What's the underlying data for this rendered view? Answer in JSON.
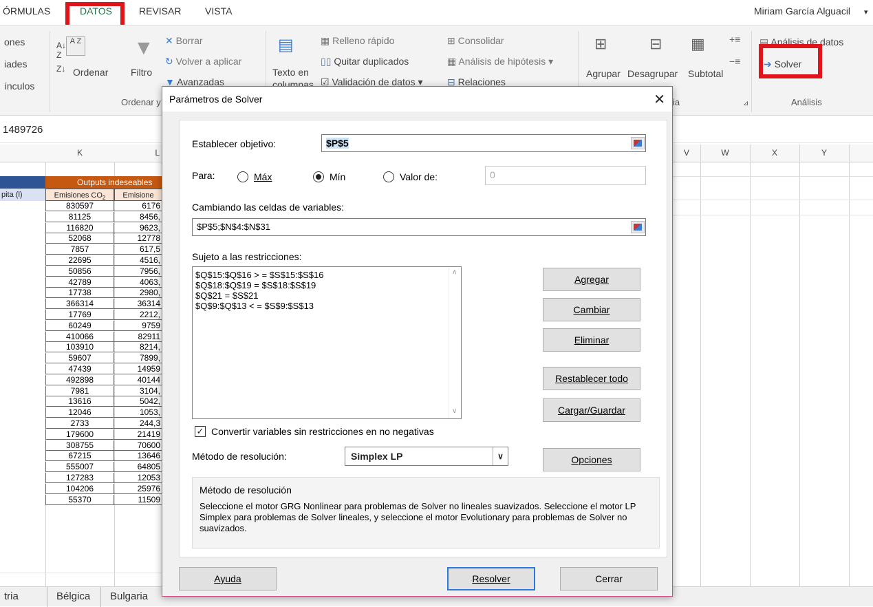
{
  "ribbon_tabs": [
    "ÓRMULAS",
    "DATOS",
    "REVISAR",
    "VISTA"
  ],
  "user_name": "Miriam García Alguacil",
  "ribbon": {
    "left_partial": [
      "ones",
      "iades",
      "ínculos"
    ],
    "ordenar": "Ordenar",
    "filtro": "Filtro",
    "borrar": "Borrar",
    "volver_aplicar": "Volver a aplicar",
    "avanzadas": "Avanzadas",
    "texto_en": "Texto en",
    "columnas": "columnas",
    "relleno_rapido": "Relleno rápido",
    "quitar_duplicados": "Quitar duplicados",
    "validacion": "Validación de datos",
    "consolidar": "Consolidar",
    "analisis_hipotesis": "Análisis de hipótesis",
    "relaciones": "Relaciones",
    "agrupar": "Agrupar",
    "desagrupar": "Desagrupar",
    "subtotal": "Subtotal",
    "analisis_datos": "Análisis de datos",
    "solver": "Solver",
    "group_ordenar": "Ordenar y",
    "group_partial": "ia",
    "group_analisis": "Análisis"
  },
  "name_box": "1489726",
  "columns": [
    "K",
    "L",
    "V",
    "W",
    "X",
    "Y"
  ],
  "sheet": {
    "header_orange": "Outputs indeseables",
    "left_header": "pita (l)",
    "k_header": "Emisiones CO",
    "k_header_sub": "2",
    "l_header": "Emisione",
    "k_values": [
      "830597",
      "81125",
      "116820",
      "52068",
      "7857",
      "22695",
      "50856",
      "42789",
      "17738",
      "366314",
      "17769",
      "60249",
      "410066",
      "103910",
      "59607",
      "47439",
      "492898",
      "7981",
      "13616",
      "12046",
      "2733",
      "179600",
      "308755",
      "67215",
      "555007",
      "127283",
      "104206",
      "55370"
    ],
    "l_values": [
      "6176",
      "8456,",
      "9623,",
      "12778",
      "617,5",
      "4516,",
      "7956,",
      "4063,",
      "2980,",
      "36314",
      "2212,",
      "9759",
      "82911",
      "8214,",
      "7899,",
      "14959",
      "40144",
      "3104,",
      "5042,",
      "1053,",
      "244,3",
      "21419",
      "70600",
      "13646",
      "64805",
      "12053",
      "25976",
      "11509"
    ]
  },
  "sheet_tabs": [
    "tria",
    "Bélgica",
    "Bulgaria"
  ],
  "dialog": {
    "title": "Parámetros de Solver",
    "objective_label": "Establecer objetivo:",
    "objective_value": "$P$5",
    "para_label": "Para:",
    "max_label": "Máx",
    "min_label": "Mín",
    "valor_label": "Valor de:",
    "valor_value": "0",
    "changing_label": "Cambiando las celdas de variables:",
    "changing_value": "$P$5;$N$4:$N$31",
    "subject_label": "Sujeto a las restricciones:",
    "constraints": [
      "$Q$15:$Q$16 > = $S$15:$S$16",
      "$Q$18:$Q$19 = $S$18:$S$19",
      "$Q$21 = $S$21",
      "$Q$9:$Q$13 < = $S$9:$S$13"
    ],
    "btn_agregar": "Agregar",
    "btn_cambiar": "Cambiar",
    "btn_eliminar": "Eliminar",
    "btn_restablecer": "Restablecer todo",
    "btn_cargar": "Cargar/Guardar",
    "checkbox_label": "Convertir variables sin restricciones en no negativas",
    "method_label": "Método de resolución:",
    "method_value": "Simplex LP",
    "btn_opciones": "Opciones",
    "method_box_title": "Método de resolución",
    "method_box_text": "Seleccione el motor GRG Nonlinear para problemas de Solver no lineales suavizados. Seleccione el motor LP Simplex para problemas de Solver lineales, y seleccione el motor Evolutionary para problemas de Solver no suavizados.",
    "btn_ayuda": "Ayuda",
    "btn_resolver": "Resolver",
    "btn_cerrar": "Cerrar"
  },
  "colors": {
    "highlight": "#e0151b",
    "orange_header": "#c65911",
    "blue_header": "#2f5496",
    "dialog_border": "#d24a8c"
  }
}
